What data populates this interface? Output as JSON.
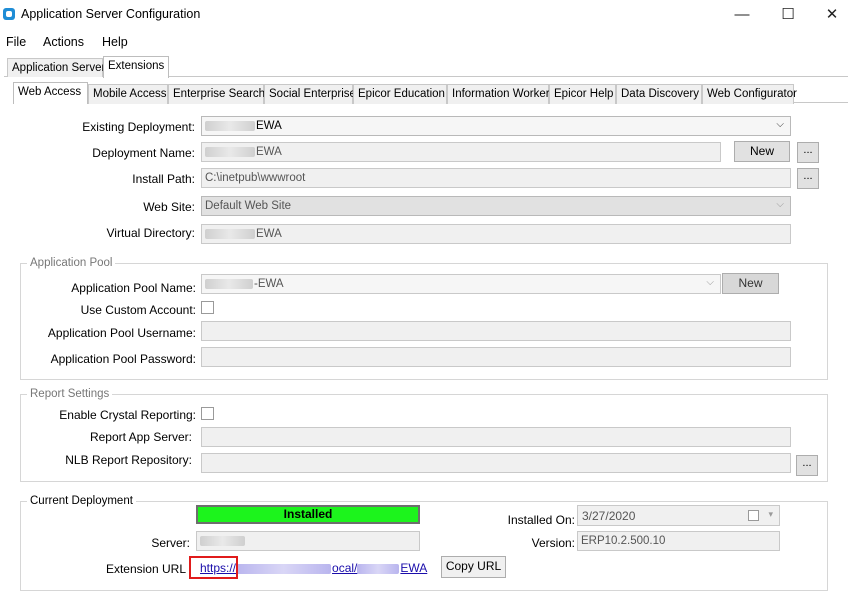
{
  "window": {
    "title": "Application Server Configuration",
    "controls": {
      "minimize": "—",
      "maximize": "☐",
      "close": "✕"
    }
  },
  "menu": [
    "File",
    "Actions",
    "Help"
  ],
  "outer_tabs": [
    "Application Server",
    "Extensions"
  ],
  "inner_tabs": [
    "Web Access",
    "Mobile Access",
    "Enterprise Search",
    "Social Enterprise",
    "Epicor Education",
    "Information Worker",
    "Epicor Help",
    "Data Discovery",
    "Web Configurator"
  ],
  "deployment": {
    "existing_label": "Existing Deployment:",
    "existing_value": "EWA",
    "name_label": "Deployment Name:",
    "name_value": "EWA",
    "new_button": "New",
    "browse_button": "...",
    "install_path_label": "Install Path:",
    "install_path_value": "C:\\inetpub\\wwwroot",
    "web_site_label": "Web Site:",
    "web_site_value": "Default Web Site",
    "virtual_dir_label": "Virtual Directory:",
    "virtual_dir_value": "EWA"
  },
  "app_pool": {
    "group_title": "Application Pool",
    "name_label": "Application Pool Name:",
    "name_value": "-EWA",
    "new_button": "New",
    "custom_account_label": "Use Custom Account:",
    "username_label": "Application Pool Username:",
    "password_label": "Application Pool Password:"
  },
  "report": {
    "group_title": "Report Settings",
    "crystal_label": "Enable Crystal Reporting:",
    "server_label": "Report App Server:",
    "nlb_label": "NLB Report Repository:",
    "browse_button": "..."
  },
  "current": {
    "group_title": "Current Deployment",
    "status": "Installed",
    "status_color": "#1cf41c",
    "installed_on_label": "Installed On:",
    "installed_on_value": "3/27/2020",
    "server_label": "Server:",
    "version_label": "Version:",
    "version_value": "ERP10.2.500.10",
    "url_label": "Extension URL",
    "url_prefix": "https://",
    "url_mid": "ocal/",
    "url_suffix": "EWA",
    "copy_button": "Copy URL"
  }
}
